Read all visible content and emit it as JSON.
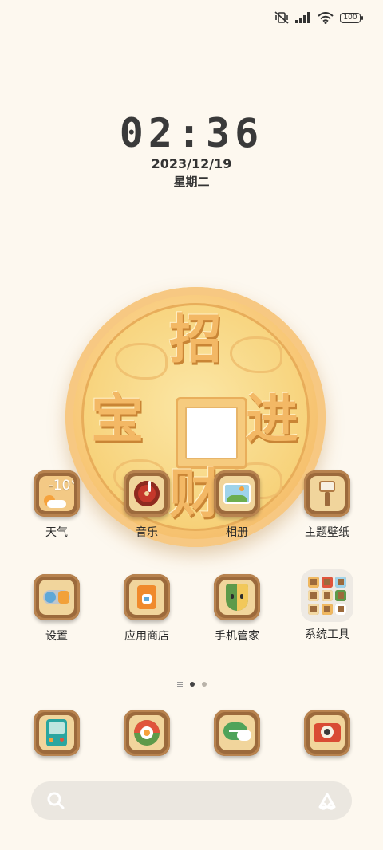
{
  "status_bar": {
    "icons": [
      "mute-vibrate-icon",
      "signal-icon",
      "wifi-icon",
      "battery-icon"
    ],
    "battery_level": "100"
  },
  "lock_clock": {
    "time": "02:36",
    "date": "2023/12/19",
    "weekday": "星期二"
  },
  "wallpaper_coin": {
    "characters": [
      "招",
      "进",
      "财",
      "宝"
    ]
  },
  "apps_row1": [
    {
      "label": "天气",
      "icon": "weather-icon",
      "temperature": "-10°"
    },
    {
      "label": "音乐",
      "icon": "music-icon"
    },
    {
      "label": "相册",
      "icon": "gallery-icon"
    },
    {
      "label": "主题壁纸",
      "icon": "theme-brush-icon"
    }
  ],
  "apps_row2": [
    {
      "label": "设置",
      "icon": "settings-toggle-icon"
    },
    {
      "label": "应用商店",
      "icon": "app-store-bag-icon"
    },
    {
      "label": "手机管家",
      "icon": "security-shield-icon"
    },
    {
      "label": "系统工具",
      "icon": "system-tools-folder-icon"
    }
  ],
  "page_indicator": {
    "pages": 2,
    "current": 1
  },
  "dock": [
    {
      "icon": "phone-icon"
    },
    {
      "icon": "browser-icon"
    },
    {
      "icon": "messages-icon"
    },
    {
      "icon": "camera-icon"
    }
  ],
  "search_bar": {
    "left_icon": "search-icon",
    "right_icon": "assistant-icon"
  },
  "colors": {
    "background": "#fdf8ef",
    "icon_frame": "#9c6a3c",
    "coin": "#f8c877"
  }
}
